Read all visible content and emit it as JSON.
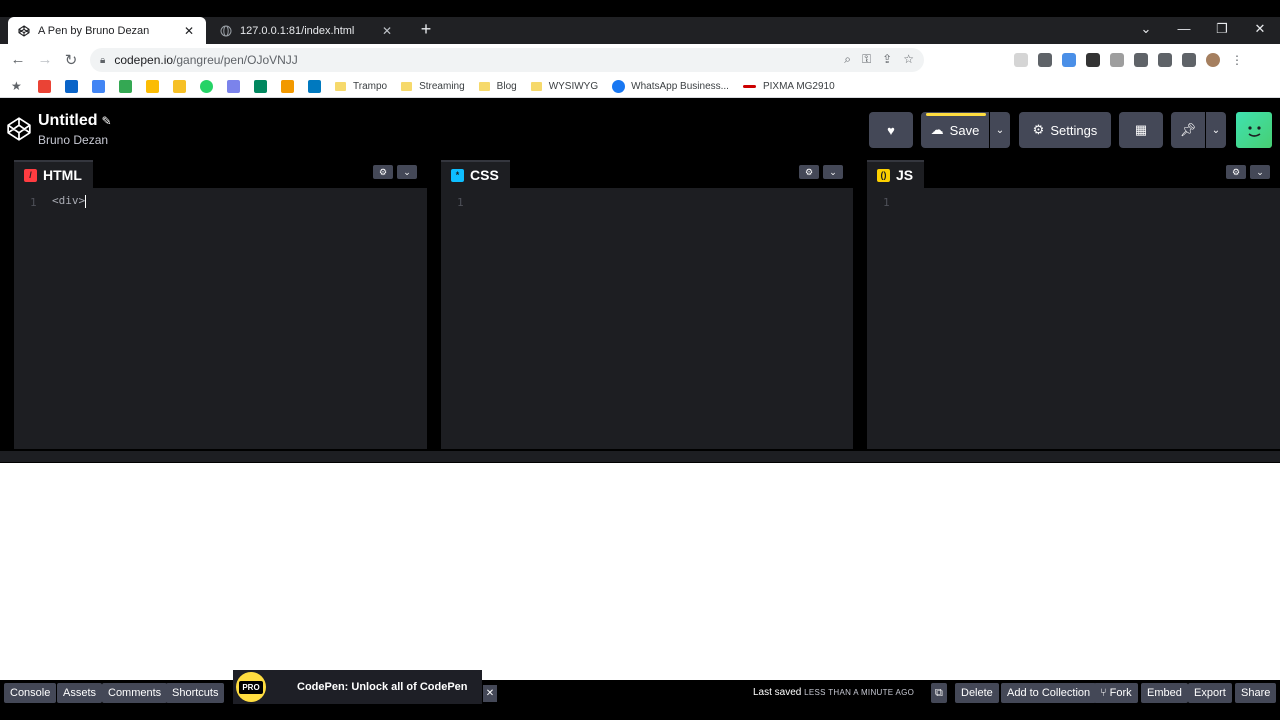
{
  "browser": {
    "tabs": [
      {
        "title": "A Pen by Bruno Dezan",
        "active": true
      },
      {
        "title": "127.0.0.1:81/index.html",
        "active": false
      }
    ],
    "url_host": "codepen.io",
    "url_path": "/gangreu/pen/OJoVNJJ",
    "bookmarks": [
      "Trampo",
      "Streaming",
      "Blog",
      "WYSIWYG",
      "WhatsApp Business...",
      "PIXMA MG2910"
    ]
  },
  "header": {
    "title": "Untitled",
    "author": "Bruno Dezan",
    "save_label": "Save",
    "settings_label": "Settings"
  },
  "editors": [
    {
      "lang": "HTML",
      "icon_color": "#ff3c41",
      "gutter": "1",
      "code": "<div>"
    },
    {
      "lang": "CSS",
      "icon_color": "#0ebeff",
      "gutter": "1",
      "code": ""
    },
    {
      "lang": "JS",
      "icon_color": "#fcd000",
      "gutter": "1",
      "code": ""
    }
  ],
  "footer": {
    "left_buttons": [
      "Console",
      "Assets",
      "Comments",
      "Shortcuts"
    ],
    "promo_badge": "PRO",
    "promo_text": "CodePen: Unlock all of CodePen",
    "last_saved_label": "Last saved",
    "last_saved_ago": "LESS THAN A MINUTE AGO",
    "right_buttons": [
      "Delete",
      "Add to Collection",
      "Fork",
      "Embed",
      "Export",
      "Share"
    ]
  }
}
